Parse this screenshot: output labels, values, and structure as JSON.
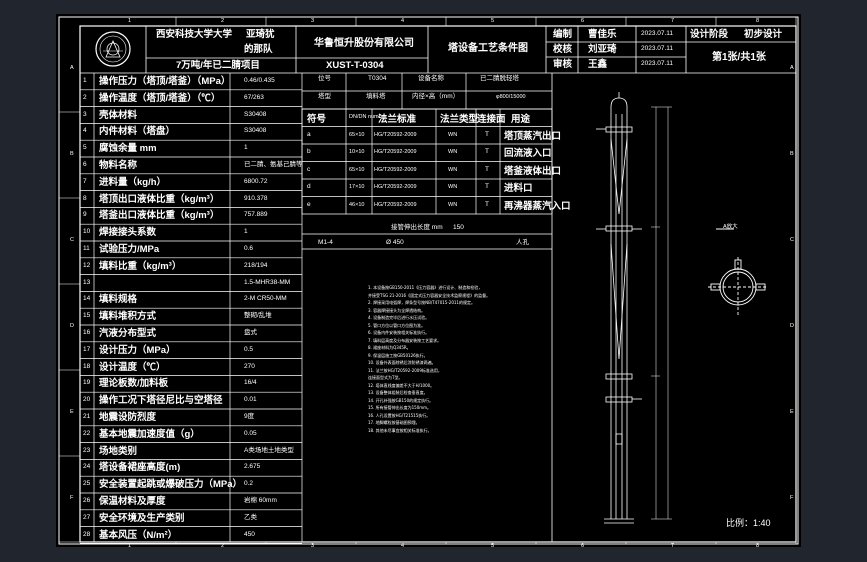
{
  "title_block": {
    "school": "西安科技大学大学",
    "school2": "的那队",
    "author_name": "亚琦犹",
    "project": "7万吨/年已二腈项目",
    "company": "华鲁恒升股份有限公司",
    "drawing_no": "XUST-T-0304",
    "drawing_title": "塔设备工艺条件图",
    "roles": [
      {
        "role": "编制",
        "name": "曹佳乐",
        "date": "2023.07.11"
      },
      {
        "role": "校核",
        "name": "刘亚琦",
        "date": "2023.07.11"
      },
      {
        "role": "审核",
        "name": "王鑫",
        "date": "2023.07.11"
      }
    ],
    "stage_label": "设计阶段",
    "stage_value": "初步设计",
    "sheet": "第1张/共1张",
    "scale": "比例：1:40"
  },
  "params": [
    {
      "no": "1",
      "label": "操作压力（塔顶/塔釜）（MPa）",
      "value": "0.46/0.435"
    },
    {
      "no": "2",
      "label": "操作温度（塔顶/塔釜）（℃）",
      "value": "67/263"
    },
    {
      "no": "3",
      "label": "壳体材料",
      "value": "S30408"
    },
    {
      "no": "4",
      "label": "内件材料（塔盘）",
      "value": "S30408"
    },
    {
      "no": "5",
      "label": "腐蚀余量 mm",
      "value": "1"
    },
    {
      "no": "6",
      "label": "物料名称",
      "value": "已二腈、氨基己腈等"
    },
    {
      "no": "7",
      "label": "进料量（kg/h）",
      "value": "6800.72"
    },
    {
      "no": "8",
      "label": "塔顶出口液体比重（kg/m³）",
      "value": "910.378"
    },
    {
      "no": "9",
      "label": "塔釜出口液体比重（kg/m³）",
      "value": "757.889"
    },
    {
      "no": "10",
      "label": "焊接接头系数",
      "value": "1"
    },
    {
      "no": "11",
      "label": "试验压力/MPa",
      "value": "0.6"
    },
    {
      "no": "12",
      "label": "填料比重（kg/m³）",
      "value": "218/194"
    },
    {
      "no": "13",
      "label": "",
      "value": "1.5-MHR38-MM"
    },
    {
      "no": "14",
      "label": "填料规格",
      "value": "2-M CR50-MM"
    },
    {
      "no": "15",
      "label": "填料堆积方式",
      "value": "整砌/乱堆"
    },
    {
      "no": "16",
      "label": "汽液分布型式",
      "value": "盘式"
    },
    {
      "no": "17",
      "label": "设计压力（MPa）",
      "value": "0.5"
    },
    {
      "no": "18",
      "label": "设计温度（℃）",
      "value": "270"
    },
    {
      "no": "19",
      "label": "理论板数/加料板",
      "value": "16/4"
    },
    {
      "no": "20",
      "label": "操作工况下塔径尼比与空塔径",
      "value": "0.01"
    },
    {
      "no": "21",
      "label": "地震设防烈度",
      "value": "9度"
    },
    {
      "no": "22",
      "label": "基本地震加速度值（g）",
      "value": "0.05"
    },
    {
      "no": "23",
      "label": "场地类别",
      "value": "A类场地土地类型"
    },
    {
      "no": "24",
      "label": "塔设备裙座高度(m)",
      "value": "2.675"
    },
    {
      "no": "25",
      "label": "安全装置起跳或爆破压力（MPa）",
      "value": "0.2"
    },
    {
      "no": "26",
      "label": "保温材料及厚度",
      "value": "岩棉 60mm"
    },
    {
      "no": "27",
      "label": "安全环境及生产类别",
      "value": "乙类"
    },
    {
      "no": "28",
      "label": "基本风压（N/m²）",
      "value": "450"
    }
  ],
  "equip": {
    "tag_label": "位号",
    "tag": "T0304",
    "name_label": "设备名称",
    "name": "已二腈脱轻塔",
    "type_label": "塔型",
    "type": "填料塔",
    "dim_label": "内径×高（mm）",
    "dim": "φ800/15000"
  },
  "nozzles": {
    "headers": [
      "符号",
      "DN/DN number",
      "法兰标准",
      "法兰类型",
      "连接面",
      "用途"
    ],
    "rows": [
      {
        "sym": "a",
        "dn": "65×10",
        "std": "HG/T20592-2009",
        "type": "WN",
        "face": "T",
        "use": "塔顶蒸汽出口"
      },
      {
        "sym": "b",
        "dn": "10×10",
        "std": "HG/T20592-2009",
        "type": "WN",
        "face": "T",
        "use": "回流液入口"
      },
      {
        "sym": "c",
        "dn": "65×10",
        "std": "HG/T20592-2009",
        "type": "WN",
        "face": "T",
        "use": "塔釜液体出口"
      },
      {
        "sym": "d",
        "dn": "17×10",
        "std": "HG/T20592-2009",
        "type": "WN",
        "face": "T",
        "use": "进料口"
      },
      {
        "sym": "e",
        "dn": "46×10",
        "std": "HG/T20592-2009",
        "type": "WN",
        "face": "T",
        "use": "再沸器蒸汽入口"
      }
    ],
    "distance_label": "接管伸出长度 mm",
    "distance_value": "150",
    "manhole_sym": "M1-4",
    "manhole_dn": "Ø 450",
    "manhole_use": "人孔"
  },
  "section_label": "A放大",
  "notes": [
    "1. 本设备按GB150-2011《压力容器》进行设计、制造和检验，",
    "   并接受TSG 21-2016《固定式压力容器安全技术监察规程》的监督。",
    "2. 焊接采用电弧焊，焊条型号按NB/T47015-2011的规定。",
    "3. 容器焊接接头为全焊透结构。",
    "4. 设备制造完毕后进行水压试验。",
    "5. 管口方位以管口方位图为准。",
    "6. 设备内件安装按相关标准执行。",
    "7. 填料层高度及分布器安装按工艺要求。",
    "8. 裙座材料为Q345R。",
    "9. 保温层施工按GB50126执行。",
    "10. 设备外表面除锈后涂防锈漆两遍。",
    "11. 法兰按HG/T20592-2009标准选用，",
    "    连接面型式为T型。",
    "12. 塔体直线度偏差不大于H/1000。",
    "13. 设备整体组装后检查垂直度。",
    "14. 开孔补强按GB150的规定执行。",
    "15. 所有接管伸出长度为150mm。",
    "16. 人孔设置按HG/T21515执行。",
    "17. 地脚螺栓按基础图预埋。",
    "18. 其他未尽事宜按相关标准执行。"
  ],
  "border": {
    "cols": [
      "1",
      "2",
      "3",
      "4",
      "5",
      "6",
      "7",
      "8"
    ],
    "rows": [
      "A",
      "B",
      "C",
      "D",
      "E",
      "F"
    ]
  }
}
